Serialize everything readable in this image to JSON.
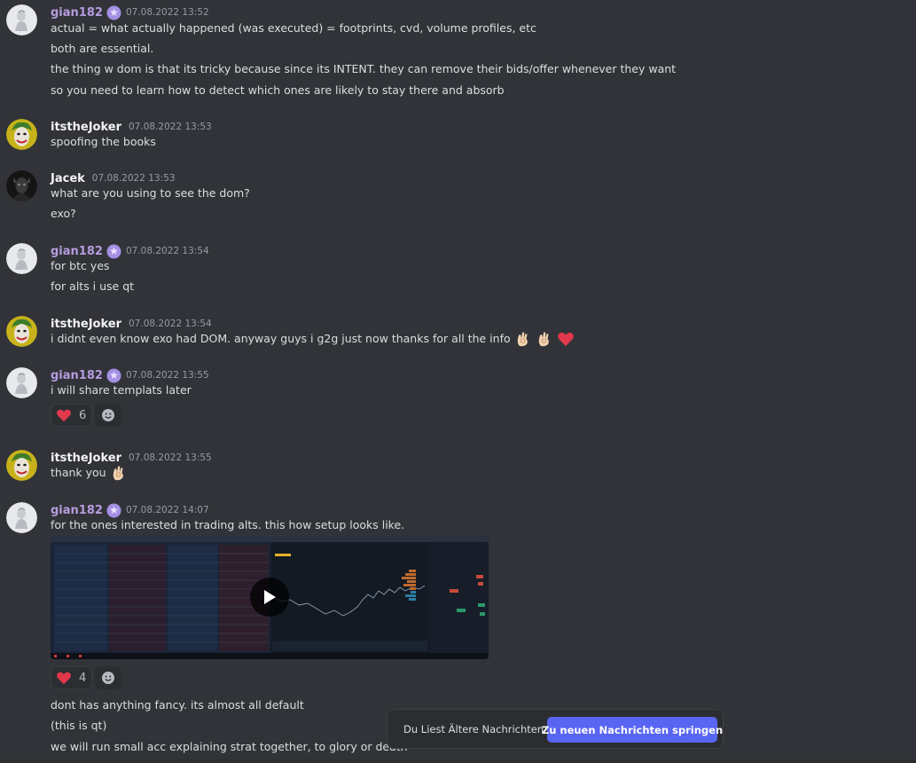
{
  "colors": {
    "background": "#313338",
    "accent": "#5865f2",
    "gian_name": "#b69cde",
    "heart": "#e3384c"
  },
  "messages": [
    {
      "author": "gian182",
      "time": "07.08.2022 13:52",
      "lines": [
        "actual = what actually happened (was executed) = footprints, cvd, volume profiles, etc",
        "both are essential.",
        "the thing w dom is that its tricky because since its INTENT. they can remove their bids/offer whenever they want",
        "so you need to learn how to detect which ones are likely to stay there and absorb"
      ]
    },
    {
      "author": "itstheJoker",
      "time": "07.08.2022 13:53",
      "lines": [
        "spoofing the books"
      ]
    },
    {
      "author": "Jacek",
      "time": "07.08.2022 13:53",
      "lines": [
        "what are you using to see the dom?",
        "exo?"
      ]
    },
    {
      "author": "gian182",
      "time": "07.08.2022 13:54",
      "lines": [
        "for btc yes",
        "for alts i use qt"
      ]
    },
    {
      "author": "itstheJoker",
      "time": "07.08.2022 13:54",
      "lines": [
        "i didnt even know exo had DOM.  anyway guys i g2g just now thanks for all the info"
      ],
      "emojis": [
        "ok-hand-icon",
        "ok-hand-icon",
        "red-heart-icon"
      ]
    },
    {
      "author": "gian182",
      "time": "07.08.2022 13:55",
      "lines": [
        "i will share templats later"
      ],
      "reaction": {
        "icon": "red-heart-icon",
        "count": "6"
      }
    },
    {
      "author": "itstheJoker",
      "time": "07.08.2022 13:55",
      "lines": [
        "thank you"
      ],
      "emojis": [
        "ok-hand-icon"
      ]
    },
    {
      "author": "gian182",
      "time": "07.08.2022 14:07",
      "lines": [
        "for the ones interested in trading alts. this how setup looks like."
      ],
      "attachment": "video-thumbnail",
      "reaction": {
        "icon": "red-heart-icon",
        "count": "4"
      },
      "after_lines": [
        "dont has anything fancy. its almost all default",
        "(this is qt)",
        "we will run small acc explaining strat together, to glory or death"
      ]
    }
  ],
  "jump_bar": {
    "label": "Du Liest Ältere Nachrichten",
    "button": "Zu neuen Nachrichten springen"
  }
}
